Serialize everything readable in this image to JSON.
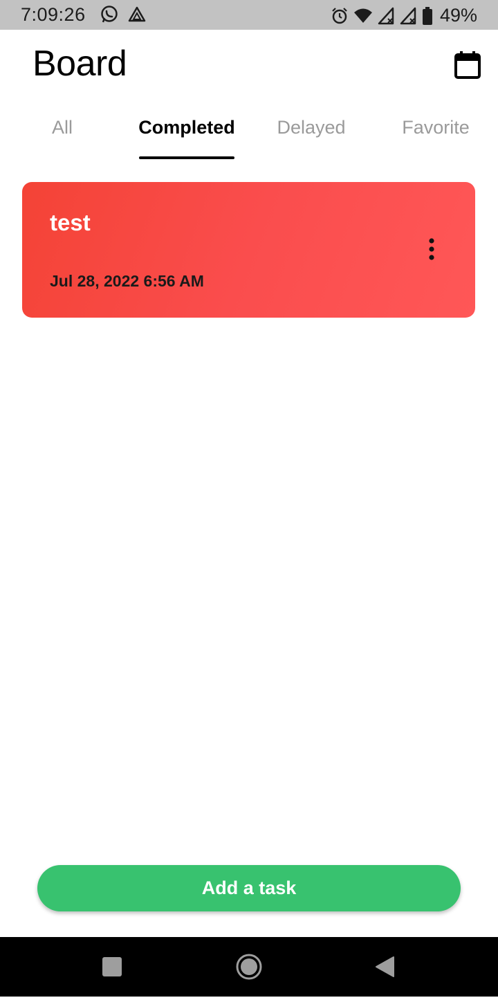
{
  "status_bar": {
    "time": "7:09:26",
    "battery": "49%",
    "left_icons": [
      "whatsapp-icon",
      "drive-icon"
    ],
    "right_icons": [
      "alarm-icon",
      "wifi-icon",
      "signal-icon",
      "signal-icon",
      "battery-icon"
    ]
  },
  "header": {
    "title": "Board",
    "calendar_icon": "calendar-icon"
  },
  "tabs": [
    {
      "label": "All",
      "active": false
    },
    {
      "label": "Completed",
      "active": true
    },
    {
      "label": "Delayed",
      "active": false
    },
    {
      "label": "Favorite",
      "active": false
    }
  ],
  "tasks": [
    {
      "title": "test",
      "date": "Jul 28, 2022 6:56 AM",
      "color_from": "#f44336",
      "color_to": "#ff5757",
      "menu_icon": "more-vertical-icon"
    }
  ],
  "actions": {
    "add_task_label": "Add a task",
    "add_task_color": "#38c26f"
  },
  "navigation": [
    "recent-apps-icon",
    "home-icon",
    "back-icon"
  ]
}
